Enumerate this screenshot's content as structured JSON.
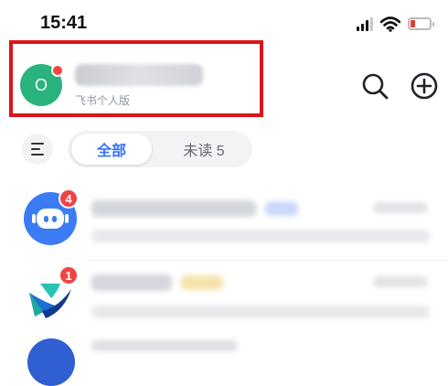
{
  "status_bar": {
    "time": "15:41",
    "icons": [
      "cellular-signal-icon",
      "wifi-icon",
      "battery-low-icon"
    ],
    "battery_color": "#e23d3d"
  },
  "header": {
    "avatar_letter": "O",
    "subtitle": "飞书个人版",
    "actions": [
      "search-icon",
      "add-circle-icon"
    ],
    "highlight_color": "#d9151b",
    "avatar_color": "#29b37d"
  },
  "filters": {
    "menu_icon": "menu-lines-icon",
    "tabs": [
      {
        "label": "全部",
        "active": true
      },
      {
        "label": "未读 5",
        "active": false
      }
    ],
    "active_color": "#3370ff"
  },
  "chats": [
    {
      "avatar_icon": "robot-icon",
      "unread": "4",
      "avatar_color": "#3b7cf5"
    },
    {
      "avatar_icon": "feishu-logo-icon",
      "unread": "1"
    }
  ]
}
